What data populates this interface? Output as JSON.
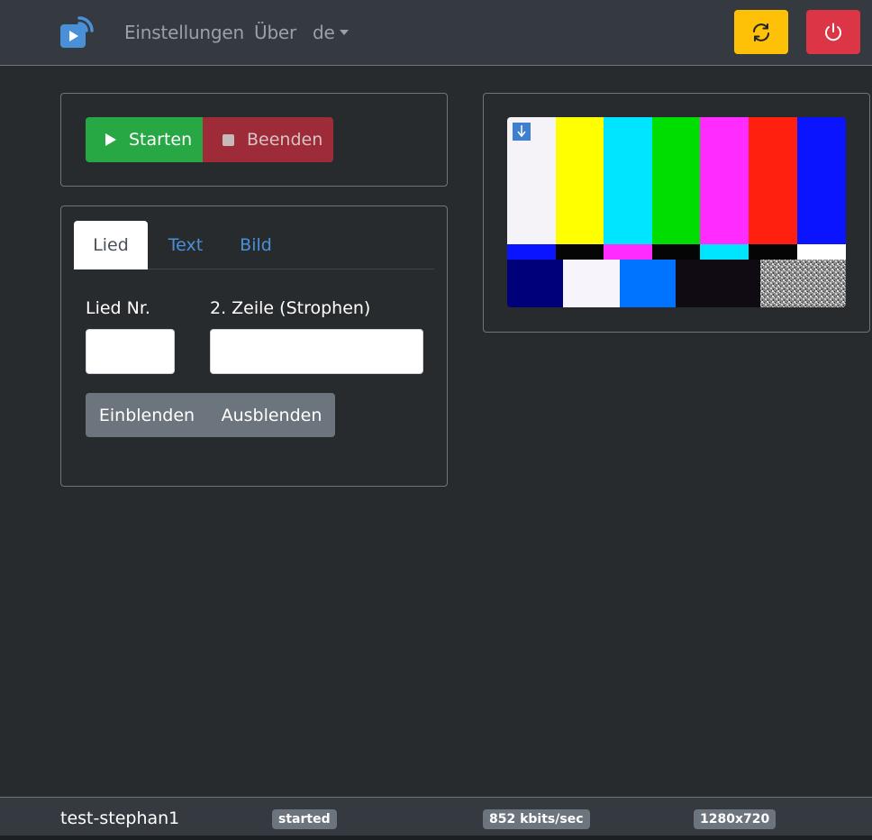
{
  "navbar": {
    "settings_label": "Einstellungen",
    "about_label": "Über",
    "language_label": "de",
    "reload_icon": "sync-icon",
    "power_icon": "power-icon"
  },
  "control": {
    "start_label": "Starten",
    "stop_label": "Beenden"
  },
  "tabs": [
    {
      "label": "Lied",
      "active": true
    },
    {
      "label": "Text",
      "active": false
    },
    {
      "label": "Bild",
      "active": false
    }
  ],
  "lied_form": {
    "number_label": "Lied Nr.",
    "number_value": "",
    "line2_label": "2. Zeile (Strophen)",
    "line2_value": "",
    "show_label": "Einblenden",
    "hide_label": "Ausblenden"
  },
  "footer": {
    "hostname": "test-stephan1",
    "status": "started",
    "bitrate": "852 kbits/sec",
    "resolution": "1280x720"
  },
  "colors": {
    "navbar_bg": "#343a40",
    "body_bg": "#272b2e",
    "success": "#28a745",
    "danger": "#dc3545",
    "warning": "#ffc107",
    "secondary": "#6c757d",
    "link": "#4a90d9"
  }
}
